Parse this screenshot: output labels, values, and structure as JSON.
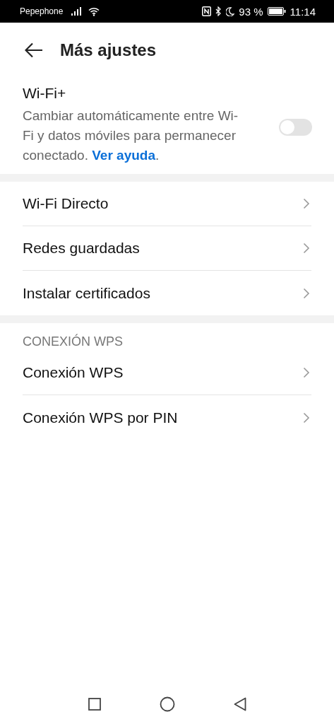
{
  "status_bar": {
    "carrier": "Pepephone",
    "battery_text": "93 %",
    "time": "11:14"
  },
  "header": {
    "title": "Más ajustes"
  },
  "wifi_plus": {
    "title": "Wi-Fi+",
    "description": "Cambiar automáticamente entre Wi-Fi y datos móviles para permanecer conectado.",
    "link": "Ver ayuda",
    "suffix": ".",
    "on": false
  },
  "groups": [
    {
      "items": [
        {
          "label": "Wi-Fi Directo"
        },
        {
          "label": "Redes guardadas"
        },
        {
          "label": "Instalar certificados"
        }
      ]
    },
    {
      "header": "CONEXIÓN WPS",
      "items": [
        {
          "label": "Conexión WPS"
        },
        {
          "label": "Conexión WPS por PIN"
        }
      ]
    }
  ]
}
